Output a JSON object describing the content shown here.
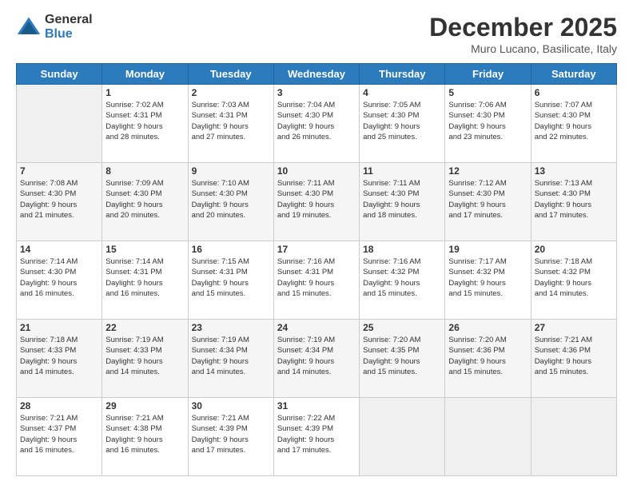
{
  "logo": {
    "general": "General",
    "blue": "Blue"
  },
  "header": {
    "month": "December 2025",
    "location": "Muro Lucano, Basilicate, Italy"
  },
  "weekdays": [
    "Sunday",
    "Monday",
    "Tuesday",
    "Wednesday",
    "Thursday",
    "Friday",
    "Saturday"
  ],
  "weeks": [
    [
      {
        "day": "",
        "info": ""
      },
      {
        "day": "1",
        "info": "Sunrise: 7:02 AM\nSunset: 4:31 PM\nDaylight: 9 hours\nand 28 minutes."
      },
      {
        "day": "2",
        "info": "Sunrise: 7:03 AM\nSunset: 4:31 PM\nDaylight: 9 hours\nand 27 minutes."
      },
      {
        "day": "3",
        "info": "Sunrise: 7:04 AM\nSunset: 4:30 PM\nDaylight: 9 hours\nand 26 minutes."
      },
      {
        "day": "4",
        "info": "Sunrise: 7:05 AM\nSunset: 4:30 PM\nDaylight: 9 hours\nand 25 minutes."
      },
      {
        "day": "5",
        "info": "Sunrise: 7:06 AM\nSunset: 4:30 PM\nDaylight: 9 hours\nand 23 minutes."
      },
      {
        "day": "6",
        "info": "Sunrise: 7:07 AM\nSunset: 4:30 PM\nDaylight: 9 hours\nand 22 minutes."
      }
    ],
    [
      {
        "day": "7",
        "info": "Sunrise: 7:08 AM\nSunset: 4:30 PM\nDaylight: 9 hours\nand 21 minutes."
      },
      {
        "day": "8",
        "info": "Sunrise: 7:09 AM\nSunset: 4:30 PM\nDaylight: 9 hours\nand 20 minutes."
      },
      {
        "day": "9",
        "info": "Sunrise: 7:10 AM\nSunset: 4:30 PM\nDaylight: 9 hours\nand 20 minutes."
      },
      {
        "day": "10",
        "info": "Sunrise: 7:11 AM\nSunset: 4:30 PM\nDaylight: 9 hours\nand 19 minutes."
      },
      {
        "day": "11",
        "info": "Sunrise: 7:11 AM\nSunset: 4:30 PM\nDaylight: 9 hours\nand 18 minutes."
      },
      {
        "day": "12",
        "info": "Sunrise: 7:12 AM\nSunset: 4:30 PM\nDaylight: 9 hours\nand 17 minutes."
      },
      {
        "day": "13",
        "info": "Sunrise: 7:13 AM\nSunset: 4:30 PM\nDaylight: 9 hours\nand 17 minutes."
      }
    ],
    [
      {
        "day": "14",
        "info": "Sunrise: 7:14 AM\nSunset: 4:30 PM\nDaylight: 9 hours\nand 16 minutes."
      },
      {
        "day": "15",
        "info": "Sunrise: 7:14 AM\nSunset: 4:31 PM\nDaylight: 9 hours\nand 16 minutes."
      },
      {
        "day": "16",
        "info": "Sunrise: 7:15 AM\nSunset: 4:31 PM\nDaylight: 9 hours\nand 15 minutes."
      },
      {
        "day": "17",
        "info": "Sunrise: 7:16 AM\nSunset: 4:31 PM\nDaylight: 9 hours\nand 15 minutes."
      },
      {
        "day": "18",
        "info": "Sunrise: 7:16 AM\nSunset: 4:32 PM\nDaylight: 9 hours\nand 15 minutes."
      },
      {
        "day": "19",
        "info": "Sunrise: 7:17 AM\nSunset: 4:32 PM\nDaylight: 9 hours\nand 15 minutes."
      },
      {
        "day": "20",
        "info": "Sunrise: 7:18 AM\nSunset: 4:32 PM\nDaylight: 9 hours\nand 14 minutes."
      }
    ],
    [
      {
        "day": "21",
        "info": "Sunrise: 7:18 AM\nSunset: 4:33 PM\nDaylight: 9 hours\nand 14 minutes."
      },
      {
        "day": "22",
        "info": "Sunrise: 7:19 AM\nSunset: 4:33 PM\nDaylight: 9 hours\nand 14 minutes."
      },
      {
        "day": "23",
        "info": "Sunrise: 7:19 AM\nSunset: 4:34 PM\nDaylight: 9 hours\nand 14 minutes."
      },
      {
        "day": "24",
        "info": "Sunrise: 7:19 AM\nSunset: 4:34 PM\nDaylight: 9 hours\nand 14 minutes."
      },
      {
        "day": "25",
        "info": "Sunrise: 7:20 AM\nSunset: 4:35 PM\nDaylight: 9 hours\nand 15 minutes."
      },
      {
        "day": "26",
        "info": "Sunrise: 7:20 AM\nSunset: 4:36 PM\nDaylight: 9 hours\nand 15 minutes."
      },
      {
        "day": "27",
        "info": "Sunrise: 7:21 AM\nSunset: 4:36 PM\nDaylight: 9 hours\nand 15 minutes."
      }
    ],
    [
      {
        "day": "28",
        "info": "Sunrise: 7:21 AM\nSunset: 4:37 PM\nDaylight: 9 hours\nand 16 minutes."
      },
      {
        "day": "29",
        "info": "Sunrise: 7:21 AM\nSunset: 4:38 PM\nDaylight: 9 hours\nand 16 minutes."
      },
      {
        "day": "30",
        "info": "Sunrise: 7:21 AM\nSunset: 4:39 PM\nDaylight: 9 hours\nand 17 minutes."
      },
      {
        "day": "31",
        "info": "Sunrise: 7:22 AM\nSunset: 4:39 PM\nDaylight: 9 hours\nand 17 minutes."
      },
      {
        "day": "",
        "info": ""
      },
      {
        "day": "",
        "info": ""
      },
      {
        "day": "",
        "info": ""
      }
    ]
  ]
}
